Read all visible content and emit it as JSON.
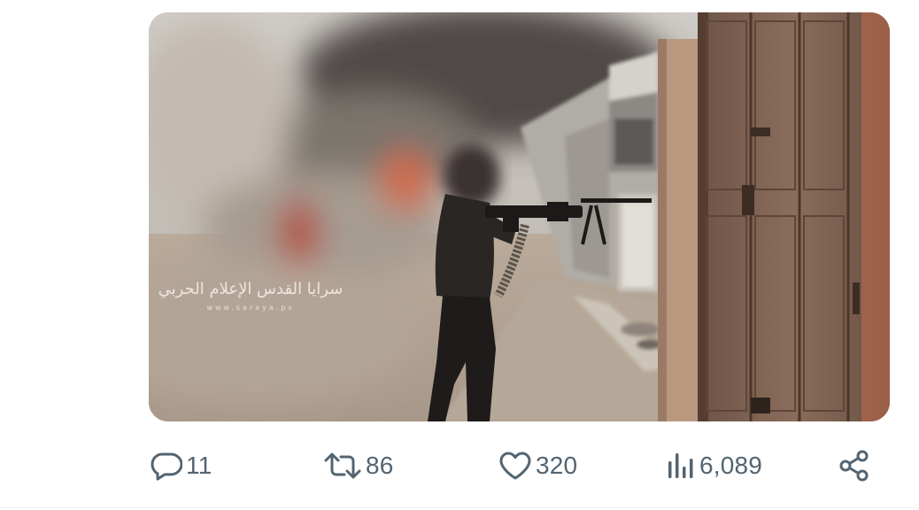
{
  "tweet": {
    "media": {
      "watermark_text": "سرايا القدس الإعلام الحربي",
      "watermark_subtext": "www.saraya.ps"
    },
    "actions": {
      "replies": {
        "icon": "reply-icon",
        "count": "11"
      },
      "reposts": {
        "icon": "repost-icon",
        "count": "86"
      },
      "likes": {
        "icon": "like-icon",
        "count": "320"
      },
      "views": {
        "icon": "views-icon",
        "count": "6,089"
      },
      "share": {
        "icon": "share-icon"
      }
    },
    "colors": {
      "action_gray": "#536471",
      "divider": "#eff3f4"
    }
  }
}
